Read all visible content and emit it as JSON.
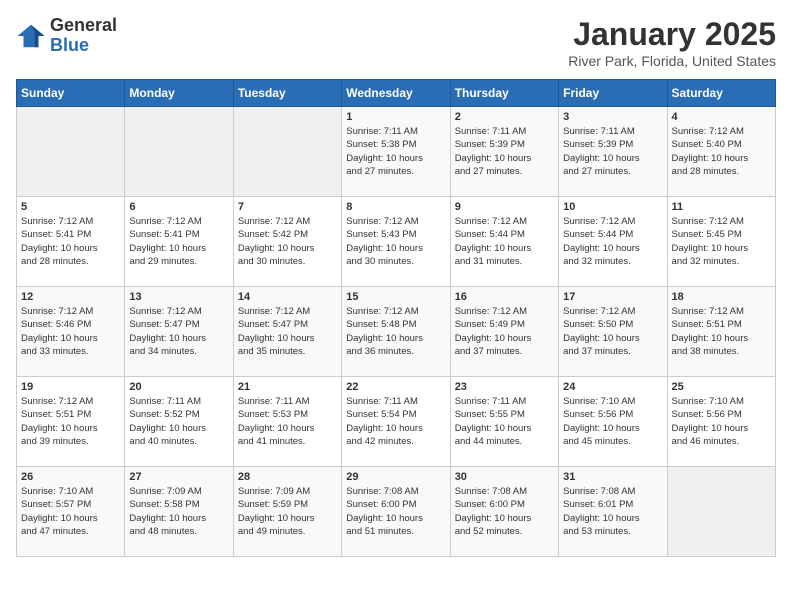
{
  "logo": {
    "general": "General",
    "blue": "Blue"
  },
  "title": "January 2025",
  "subtitle": "River Park, Florida, United States",
  "days_of_week": [
    "Sunday",
    "Monday",
    "Tuesday",
    "Wednesday",
    "Thursday",
    "Friday",
    "Saturday"
  ],
  "weeks": [
    [
      {
        "day": "",
        "info": ""
      },
      {
        "day": "",
        "info": ""
      },
      {
        "day": "",
        "info": ""
      },
      {
        "day": "1",
        "info": "Sunrise: 7:11 AM\nSunset: 5:38 PM\nDaylight: 10 hours\nand 27 minutes."
      },
      {
        "day": "2",
        "info": "Sunrise: 7:11 AM\nSunset: 5:39 PM\nDaylight: 10 hours\nand 27 minutes."
      },
      {
        "day": "3",
        "info": "Sunrise: 7:11 AM\nSunset: 5:39 PM\nDaylight: 10 hours\nand 27 minutes."
      },
      {
        "day": "4",
        "info": "Sunrise: 7:12 AM\nSunset: 5:40 PM\nDaylight: 10 hours\nand 28 minutes."
      }
    ],
    [
      {
        "day": "5",
        "info": "Sunrise: 7:12 AM\nSunset: 5:41 PM\nDaylight: 10 hours\nand 28 minutes."
      },
      {
        "day": "6",
        "info": "Sunrise: 7:12 AM\nSunset: 5:41 PM\nDaylight: 10 hours\nand 29 minutes."
      },
      {
        "day": "7",
        "info": "Sunrise: 7:12 AM\nSunset: 5:42 PM\nDaylight: 10 hours\nand 30 minutes."
      },
      {
        "day": "8",
        "info": "Sunrise: 7:12 AM\nSunset: 5:43 PM\nDaylight: 10 hours\nand 30 minutes."
      },
      {
        "day": "9",
        "info": "Sunrise: 7:12 AM\nSunset: 5:44 PM\nDaylight: 10 hours\nand 31 minutes."
      },
      {
        "day": "10",
        "info": "Sunrise: 7:12 AM\nSunset: 5:44 PM\nDaylight: 10 hours\nand 32 minutes."
      },
      {
        "day": "11",
        "info": "Sunrise: 7:12 AM\nSunset: 5:45 PM\nDaylight: 10 hours\nand 32 minutes."
      }
    ],
    [
      {
        "day": "12",
        "info": "Sunrise: 7:12 AM\nSunset: 5:46 PM\nDaylight: 10 hours\nand 33 minutes."
      },
      {
        "day": "13",
        "info": "Sunrise: 7:12 AM\nSunset: 5:47 PM\nDaylight: 10 hours\nand 34 minutes."
      },
      {
        "day": "14",
        "info": "Sunrise: 7:12 AM\nSunset: 5:47 PM\nDaylight: 10 hours\nand 35 minutes."
      },
      {
        "day": "15",
        "info": "Sunrise: 7:12 AM\nSunset: 5:48 PM\nDaylight: 10 hours\nand 36 minutes."
      },
      {
        "day": "16",
        "info": "Sunrise: 7:12 AM\nSunset: 5:49 PM\nDaylight: 10 hours\nand 37 minutes."
      },
      {
        "day": "17",
        "info": "Sunrise: 7:12 AM\nSunset: 5:50 PM\nDaylight: 10 hours\nand 37 minutes."
      },
      {
        "day": "18",
        "info": "Sunrise: 7:12 AM\nSunset: 5:51 PM\nDaylight: 10 hours\nand 38 minutes."
      }
    ],
    [
      {
        "day": "19",
        "info": "Sunrise: 7:12 AM\nSunset: 5:51 PM\nDaylight: 10 hours\nand 39 minutes."
      },
      {
        "day": "20",
        "info": "Sunrise: 7:11 AM\nSunset: 5:52 PM\nDaylight: 10 hours\nand 40 minutes."
      },
      {
        "day": "21",
        "info": "Sunrise: 7:11 AM\nSunset: 5:53 PM\nDaylight: 10 hours\nand 41 minutes."
      },
      {
        "day": "22",
        "info": "Sunrise: 7:11 AM\nSunset: 5:54 PM\nDaylight: 10 hours\nand 42 minutes."
      },
      {
        "day": "23",
        "info": "Sunrise: 7:11 AM\nSunset: 5:55 PM\nDaylight: 10 hours\nand 44 minutes."
      },
      {
        "day": "24",
        "info": "Sunrise: 7:10 AM\nSunset: 5:56 PM\nDaylight: 10 hours\nand 45 minutes."
      },
      {
        "day": "25",
        "info": "Sunrise: 7:10 AM\nSunset: 5:56 PM\nDaylight: 10 hours\nand 46 minutes."
      }
    ],
    [
      {
        "day": "26",
        "info": "Sunrise: 7:10 AM\nSunset: 5:57 PM\nDaylight: 10 hours\nand 47 minutes."
      },
      {
        "day": "27",
        "info": "Sunrise: 7:09 AM\nSunset: 5:58 PM\nDaylight: 10 hours\nand 48 minutes."
      },
      {
        "day": "28",
        "info": "Sunrise: 7:09 AM\nSunset: 5:59 PM\nDaylight: 10 hours\nand 49 minutes."
      },
      {
        "day": "29",
        "info": "Sunrise: 7:08 AM\nSunset: 6:00 PM\nDaylight: 10 hours\nand 51 minutes."
      },
      {
        "day": "30",
        "info": "Sunrise: 7:08 AM\nSunset: 6:00 PM\nDaylight: 10 hours\nand 52 minutes."
      },
      {
        "day": "31",
        "info": "Sunrise: 7:08 AM\nSunset: 6:01 PM\nDaylight: 10 hours\nand 53 minutes."
      },
      {
        "day": "",
        "info": ""
      }
    ]
  ]
}
